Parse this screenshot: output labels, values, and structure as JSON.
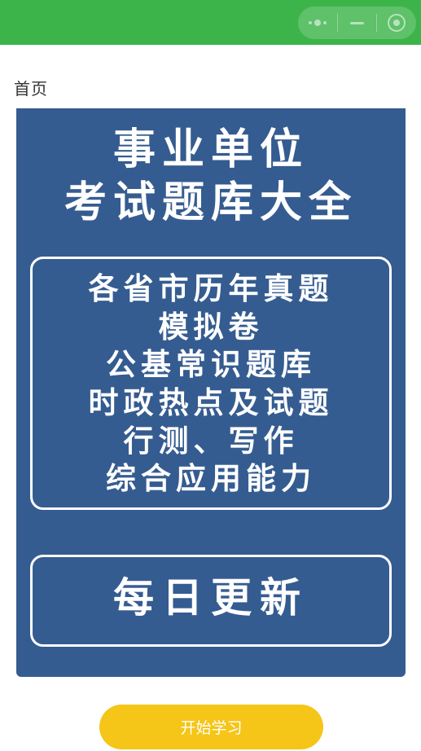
{
  "page": {
    "title": "首页"
  },
  "banner": {
    "headline_1": "事业单位",
    "headline_2": "考试题库大全",
    "features": [
      "各省市历年真题",
      "模拟卷",
      "公基常识题库",
      "时政热点及试题",
      "行测、写作",
      "综合应用能力"
    ],
    "daily_update": "每日更新"
  },
  "actions": {
    "start_label": "开始学习"
  },
  "colors": {
    "top_bar": "#3cb44a",
    "banner_bg": "#355c91",
    "button_bg": "#f5c518",
    "text_on_dark": "#ffffff"
  },
  "icons": {
    "capsule_more": "more-dots-icon",
    "capsule_minimize": "minimize-icon",
    "capsule_close": "close-target-icon"
  }
}
